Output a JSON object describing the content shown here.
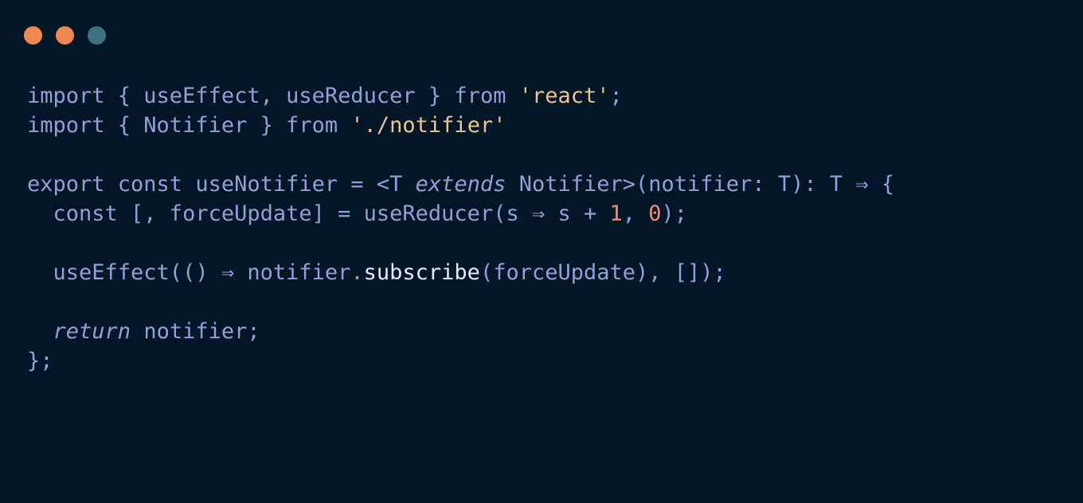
{
  "window_controls": [
    {
      "name": "close",
      "color": "#f0884e"
    },
    {
      "name": "minimize",
      "color": "#f0884e"
    },
    {
      "name": "maximize",
      "color": "#3f7180"
    }
  ],
  "colors": {
    "background": "#011627",
    "text": "#8fa2d8",
    "string": "#ecc48d",
    "number": "#f78c6c",
    "method": "#e3ecff"
  },
  "code": {
    "lines": [
      [
        {
          "t": "import { useEffect, useReducer } from "
        },
        {
          "t": "'react'",
          "c": "str"
        },
        {
          "t": ";"
        }
      ],
      [
        {
          "t": "import { Notifier } from "
        },
        {
          "t": "'./notifier'",
          "c": "str"
        }
      ],
      [],
      [
        {
          "t": "export const useNotifier = <T "
        },
        {
          "t": "extends",
          "c": "it"
        },
        {
          "t": " Notifier>(notifier: T): T ⇒ {"
        }
      ],
      [
        {
          "t": "  const [, forceUpdate] = useReducer(s ⇒ s + "
        },
        {
          "t": "1",
          "c": "num"
        },
        {
          "t": ", "
        },
        {
          "t": "0",
          "c": "num"
        },
        {
          "t": ");"
        }
      ],
      [],
      [
        {
          "t": "  useEffect(() ⇒ notifier."
        },
        {
          "t": "subscribe",
          "c": "fn"
        },
        {
          "t": "(forceUpdate), []);"
        }
      ],
      [],
      [
        {
          "t": "  "
        },
        {
          "t": "return",
          "c": "it"
        },
        {
          "t": " notifier;"
        }
      ],
      [
        {
          "t": "};"
        }
      ]
    ]
  }
}
